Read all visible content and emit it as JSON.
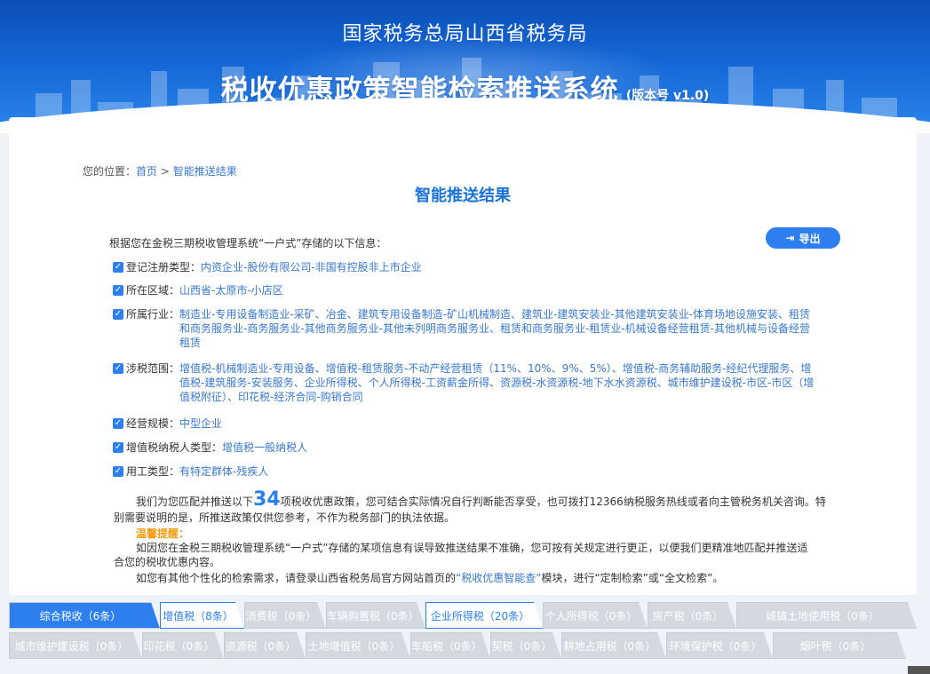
{
  "header": {
    "org": "国家税务总局山西省税务局",
    "title": "税收优惠政策智能检索推送系统",
    "version": "(版本号 v1.0)"
  },
  "breadcrumb": {
    "prefix": "您的位置：",
    "home": "首页",
    "sep": " > ",
    "current": "智能推送结果"
  },
  "page_title": "智能推送结果",
  "export_label": "导出",
  "intro": "根据您在金税三期税收管理系统“一户式”存储的以下信息：",
  "info": [
    {
      "label": "登记注册类型：",
      "value": "内资企业-股份有限公司-非国有控股非上市企业"
    },
    {
      "label": "所在区域：",
      "value": "山西省-太原市-小店区"
    },
    {
      "label": "所属行业：",
      "value": "制造业-专用设备制造业-采矿、冶金、建筑专用设备制造-矿山机械制造、建筑业-建筑安装业-其他建筑安装业-体育场地设施安装、租赁和商务服务业-商务服务业-其他商务服务业-其他未列明商务服务业、租赁和商务服务业-租赁业-机械设备经营租赁-其他机械与设备经营租赁"
    },
    {
      "label": "涉税范围：",
      "value": "增值税-机械制造业-专用设备、增值税-租赁服务-不动产经营租赁（11%、10%、9%、5%）、增值税-商务辅助服务-经纪代理服务、增值税-建筑服务-安装服务、企业所得税、个人所得税-工资薪金所得、资源税-水资源税-地下水水资源税、城市维护建设税-市区-市区（增值税附征）、印花税-经济合同-购销合同"
    },
    {
      "label": "经营规模：",
      "value": "中型企业"
    },
    {
      "label": "增值税纳税人类型：",
      "value": "增值税一般纳税人"
    },
    {
      "label": "用工类型：",
      "value": "有特定群体-残疾人"
    }
  ],
  "result": {
    "pre": "我们为您匹配并推送以下",
    "count": "34",
    "post1": "项税收优惠政策，您可结合实际情况自行判断能否享受，也可拨打12366纳税服务热线或者向主管税务机关咨询。特",
    "line2": "别需要说明的是，所推送政策仅供您参考，不作为税务部门的执法依据。"
  },
  "tip_label": "温馨提醒：",
  "tip": {
    "line1": "如因您在金税三期税收管理系统“一户式”存储的某项信息有误导致推送结果不准确，您可按有关规定进行更正，以便我们更精准地匹配并推送适",
    "line2": "合您的税收优惠内容。",
    "line3_pre": "如您有其他个性化的检索需求，请登录山西省税务局官方网站首页的",
    "line3_link": "“税收优惠智能查”",
    "line3_post": "模块，进行“定制检索”或“全文检索”。"
  },
  "tabs_row1": [
    {
      "label": "综合税收（6条）",
      "state": "active"
    },
    {
      "label": "增值税（8条）",
      "state": "white"
    },
    {
      "label": "消费税（0条）",
      "state": "normal"
    },
    {
      "label": "车辆购置税（0条）",
      "state": "normal"
    },
    {
      "label": "企业所得税（20条）",
      "state": "white"
    },
    {
      "label": "个人所得税（0条）",
      "state": "normal"
    },
    {
      "label": "房产税（0条）",
      "state": "normal"
    },
    {
      "label": "城镇土地使用税（0条）",
      "state": "normal"
    }
  ],
  "tabs_row2": [
    {
      "label": "城市维护建设税（0条）"
    },
    {
      "label": "印花税（0条）"
    },
    {
      "label": "资源税（0条）"
    },
    {
      "label": "土地增值税（0条）"
    },
    {
      "label": "车船税（0条）"
    },
    {
      "label": "契税（0条）"
    },
    {
      "label": "耕地占用税（0条）"
    },
    {
      "label": "环境保护税（0条）"
    },
    {
      "label": "烟叶税（0条）"
    }
  ],
  "colors": {
    "accent": "#2d7ff0",
    "link": "#3a78c9",
    "tip": "#f39c12",
    "tab_inactive": "#d4d9e0"
  }
}
